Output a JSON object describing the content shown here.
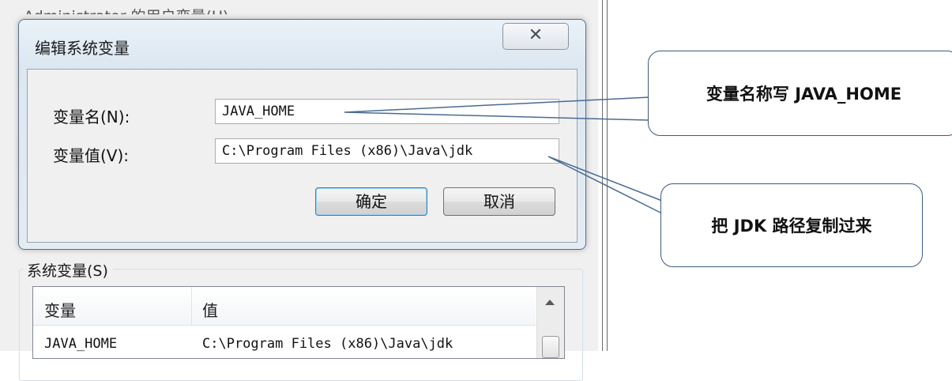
{
  "background_window": {
    "user_vars_label": "Administrator 的用户变量(U)",
    "system_vars_label": "系统变量(S)",
    "table": {
      "columns": [
        "变量",
        "值"
      ],
      "rows": [
        {
          "name": "JAVA_HOME",
          "value": "C:\\Program Files (x86)\\Java\\jdk"
        }
      ]
    }
  },
  "dialog": {
    "title": "编辑系统变量",
    "close_icon": "close-icon",
    "name_label": "变量名(N):",
    "name_value": "JAVA_HOME",
    "value_label": "变量值(V):",
    "value_value": "C:\\Program Files (x86)\\Java\\jdk",
    "ok_label": "确定",
    "cancel_label": "取消"
  },
  "annotations": {
    "name_note": "变量名称写 JAVA_HOME",
    "value_note": "把 JDK 路径复制过来",
    "line_color": "#4a6b93"
  }
}
